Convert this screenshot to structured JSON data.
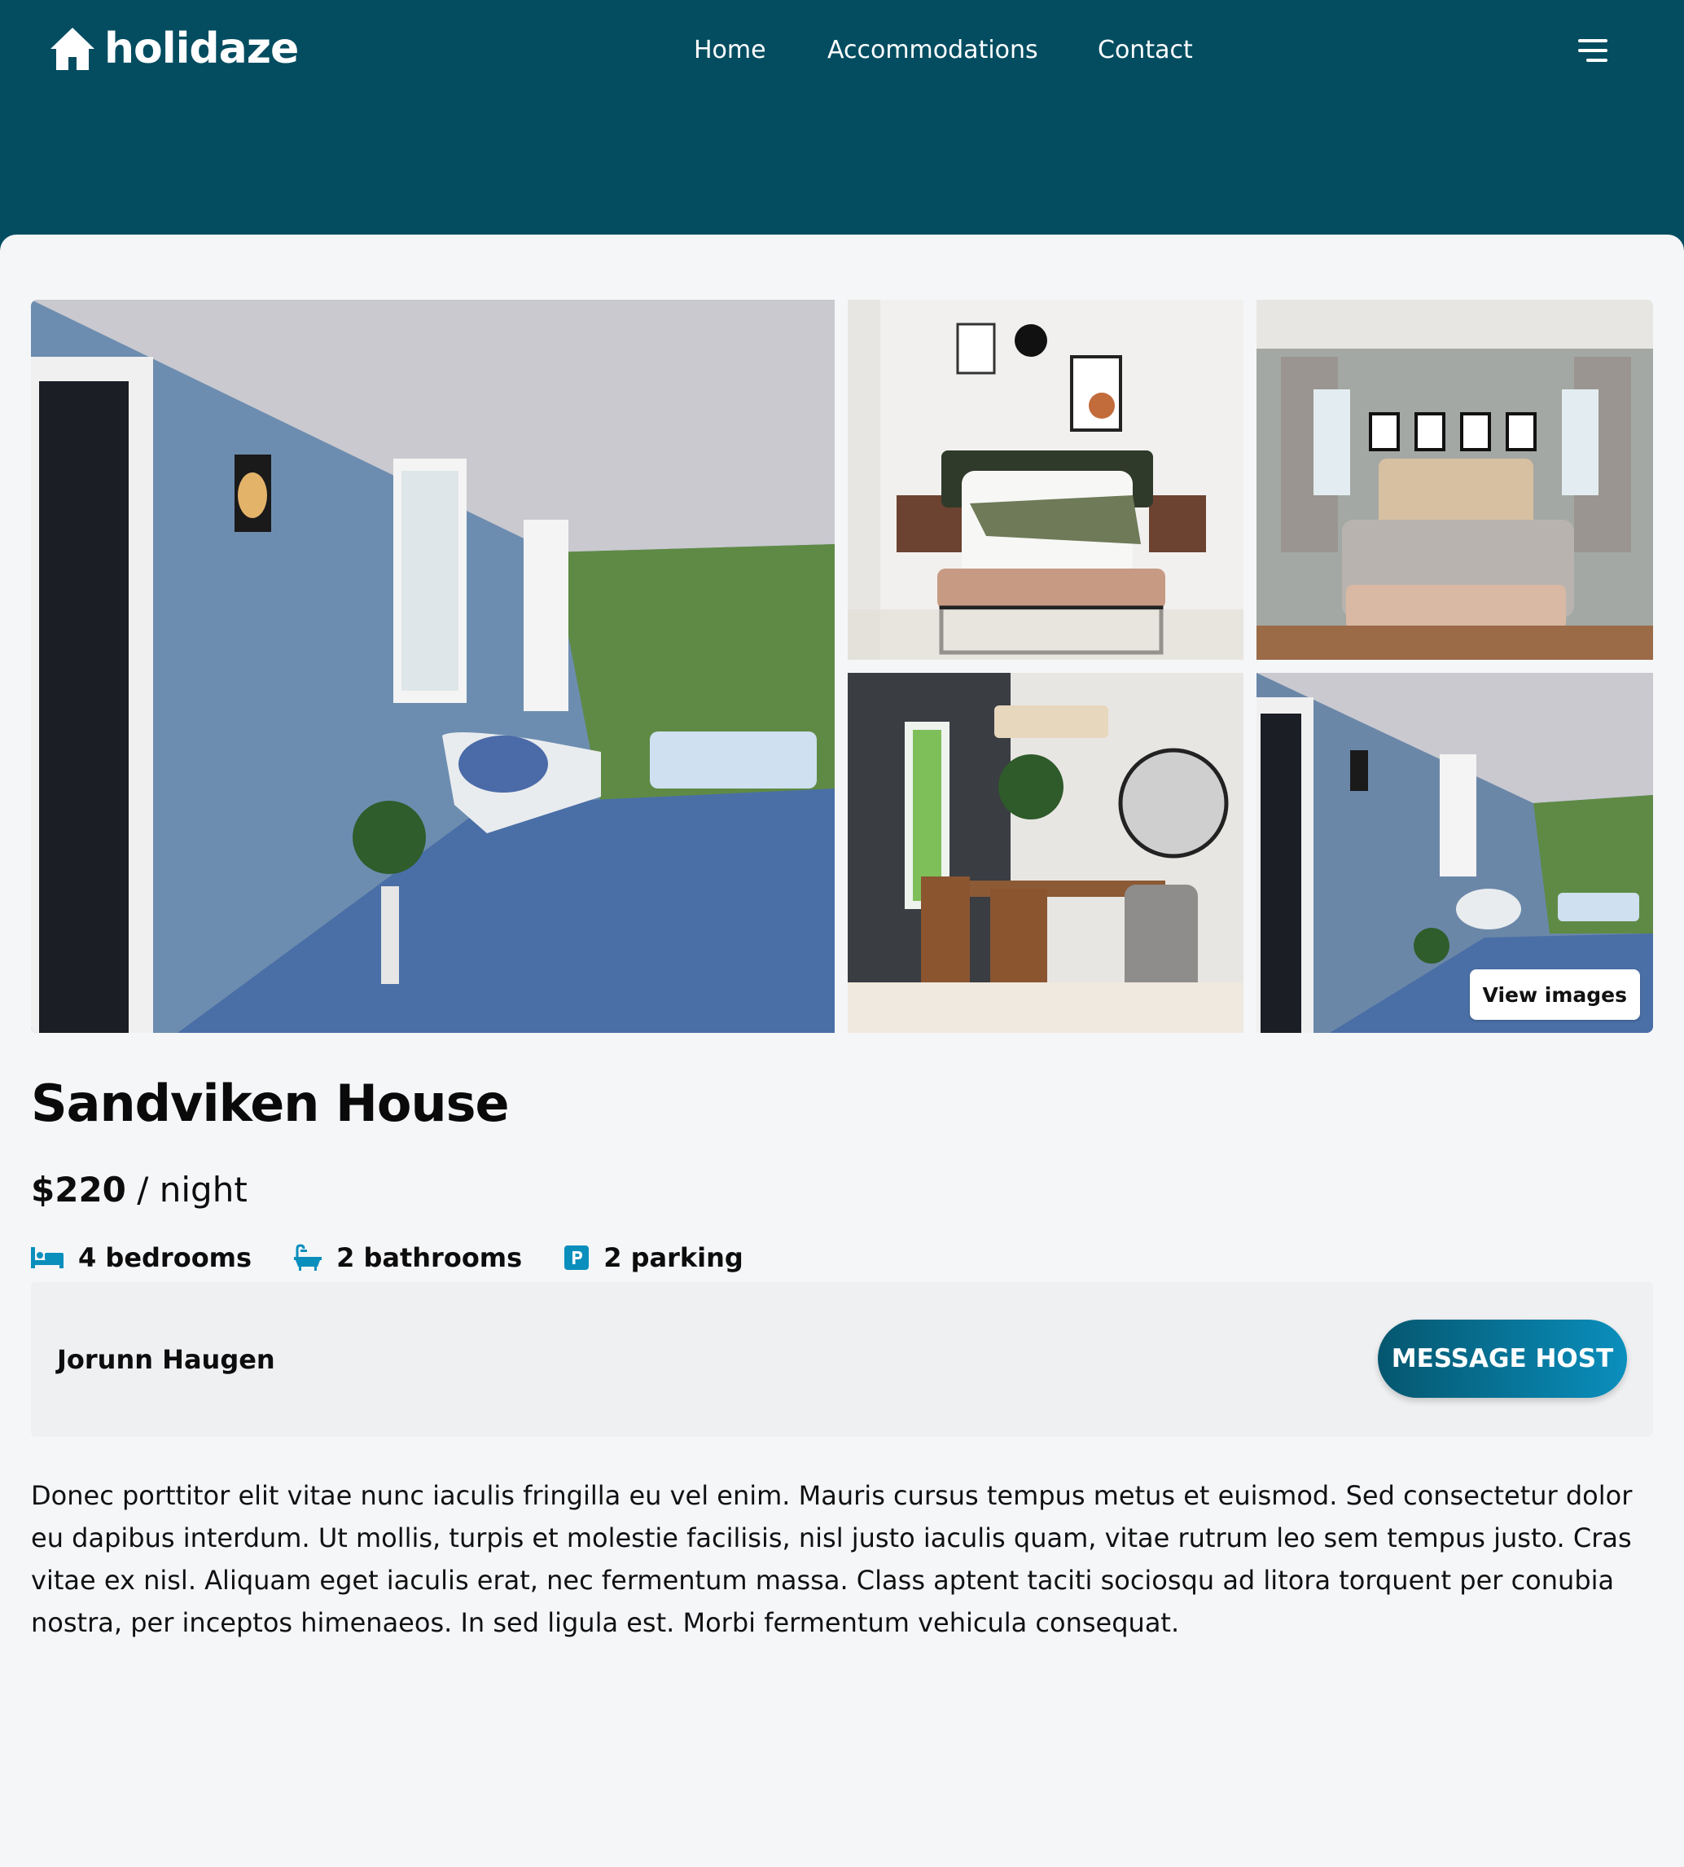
{
  "brand": {
    "name": "holidaze",
    "logo_icon": "house-icon",
    "color": "#044d61"
  },
  "nav": {
    "links": [
      "Home",
      "Accommodations",
      "Contact"
    ],
    "menu_icon": "hamburger-menu-icon"
  },
  "gallery": {
    "images": [
      {
        "alt": "Porch with wicker chair and swing"
      },
      {
        "alt": "Bedroom with green pillows"
      },
      {
        "alt": "Bedroom with framed art"
      },
      {
        "alt": "Dining room"
      },
      {
        "alt": "Porch"
      }
    ],
    "view_images_label": "View images"
  },
  "listing": {
    "title": "Sandviken House",
    "price_amount": "$220",
    "price_unit": " / night",
    "features": [
      {
        "icon": "bed-icon",
        "label": "4 bedrooms"
      },
      {
        "icon": "bathtub-icon",
        "label": "2 bathrooms"
      },
      {
        "icon": "parking-icon",
        "label": "2 parking"
      }
    ],
    "accent_color": "#0a8fbd"
  },
  "host": {
    "name": "Jorunn Haugen",
    "message_label": "MESSAGE HOST"
  },
  "description": "Donec porttitor elit vitae nunc iaculis fringilla eu vel enim. Mauris cursus tempus metus et euismod. Sed consectetur dolor eu dapibus interdum. Ut mollis, turpis et molestie facilisis, nisl justo iaculis quam, vitae rutrum leo sem tempus justo. Cras vitae ex nisl. Aliquam eget iaculis erat, nec fermentum massa. Class aptent taciti sociosqu ad litora torquent per conubia nostra, per inceptos himenaeos. In sed ligula est. Morbi fermentum vehicula consequat."
}
